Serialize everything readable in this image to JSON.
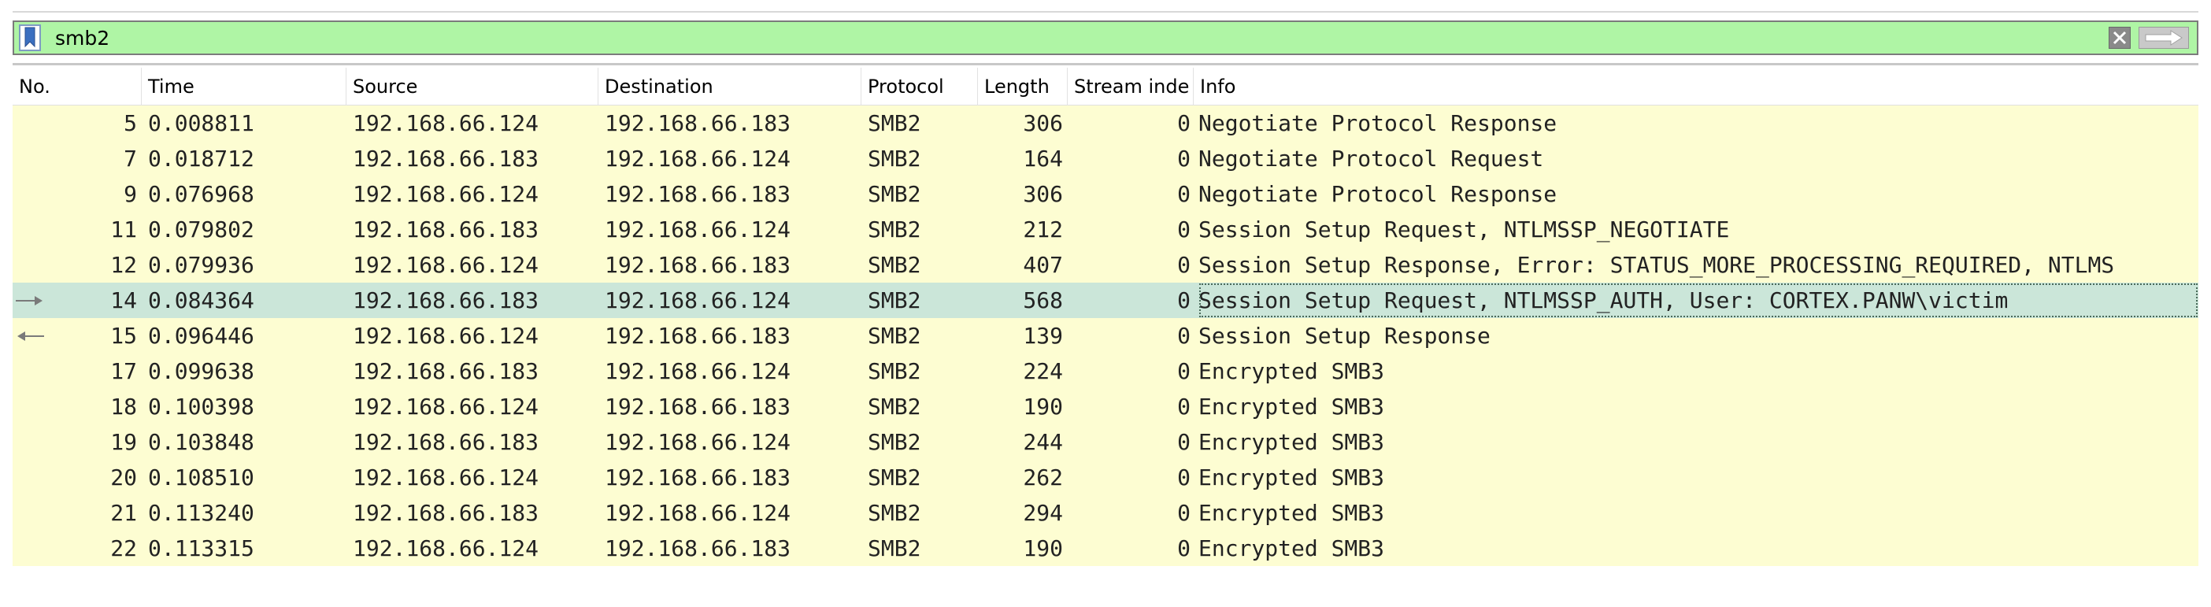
{
  "filter": {
    "value": "smb2"
  },
  "columns": [
    "No.",
    "Time",
    "Source",
    "Destination",
    "Protocol",
    "Length",
    "Stream inde",
    "Info"
  ],
  "packets": [
    {
      "no": "5",
      "time": "0.008811",
      "source": "192.168.66.124",
      "destination": "192.168.66.183",
      "protocol": "SMB2",
      "length": "306",
      "stream": "0",
      "info": "Negotiate Protocol Response"
    },
    {
      "no": "7",
      "time": "0.018712",
      "source": "192.168.66.183",
      "destination": "192.168.66.124",
      "protocol": "SMB2",
      "length": "164",
      "stream": "0",
      "info": "Negotiate Protocol Request"
    },
    {
      "no": "9",
      "time": "0.076968",
      "source": "192.168.66.124",
      "destination": "192.168.66.183",
      "protocol": "SMB2",
      "length": "306",
      "stream": "0",
      "info": "Negotiate Protocol Response"
    },
    {
      "no": "11",
      "time": "0.079802",
      "source": "192.168.66.183",
      "destination": "192.168.66.124",
      "protocol": "SMB2",
      "length": "212",
      "stream": "0",
      "info": "Session Setup Request, NTLMSSP_NEGOTIATE"
    },
    {
      "no": "12",
      "time": "0.079936",
      "source": "192.168.66.124",
      "destination": "192.168.66.183",
      "protocol": "SMB2",
      "length": "407",
      "stream": "0",
      "info": "Session Setup Response, Error: STATUS_MORE_PROCESSING_REQUIRED, NTLMS"
    },
    {
      "no": "14",
      "time": "0.084364",
      "source": "192.168.66.183",
      "destination": "192.168.66.124",
      "protocol": "SMB2",
      "length": "568",
      "stream": "0",
      "info": "Session Setup Request, NTLMSSP_AUTH, User: CORTEX.PANW\\victim"
    },
    {
      "no": "15",
      "time": "0.096446",
      "source": "192.168.66.124",
      "destination": "192.168.66.183",
      "protocol": "SMB2",
      "length": "139",
      "stream": "0",
      "info": "Session Setup Response"
    },
    {
      "no": "17",
      "time": "0.099638",
      "source": "192.168.66.183",
      "destination": "192.168.66.124",
      "protocol": "SMB2",
      "length": "224",
      "stream": "0",
      "info": "Encrypted SMB3"
    },
    {
      "no": "18",
      "time": "0.100398",
      "source": "192.168.66.124",
      "destination": "192.168.66.183",
      "protocol": "SMB2",
      "length": "190",
      "stream": "0",
      "info": "Encrypted SMB3"
    },
    {
      "no": "19",
      "time": "0.103848",
      "source": "192.168.66.183",
      "destination": "192.168.66.124",
      "protocol": "SMB2",
      "length": "244",
      "stream": "0",
      "info": "Encrypted SMB3"
    },
    {
      "no": "20",
      "time": "0.108510",
      "source": "192.168.66.124",
      "destination": "192.168.66.183",
      "protocol": "SMB2",
      "length": "262",
      "stream": "0",
      "info": "Encrypted SMB3"
    },
    {
      "no": "21",
      "time": "0.113240",
      "source": "192.168.66.183",
      "destination": "192.168.66.124",
      "protocol": "SMB2",
      "length": "294",
      "stream": "0",
      "info": "Encrypted SMB3"
    },
    {
      "no": "22",
      "time": "0.113315",
      "source": "192.168.66.124",
      "destination": "192.168.66.183",
      "protocol": "SMB2",
      "length": "190",
      "stream": "0",
      "info": "Encrypted SMB3"
    }
  ],
  "selected_packet_no": "14",
  "colors": {
    "filter_valid_bg": "#aff5a5",
    "row_bg": "#fdfdd2",
    "selected_row_bg": "#cbe6d9"
  }
}
